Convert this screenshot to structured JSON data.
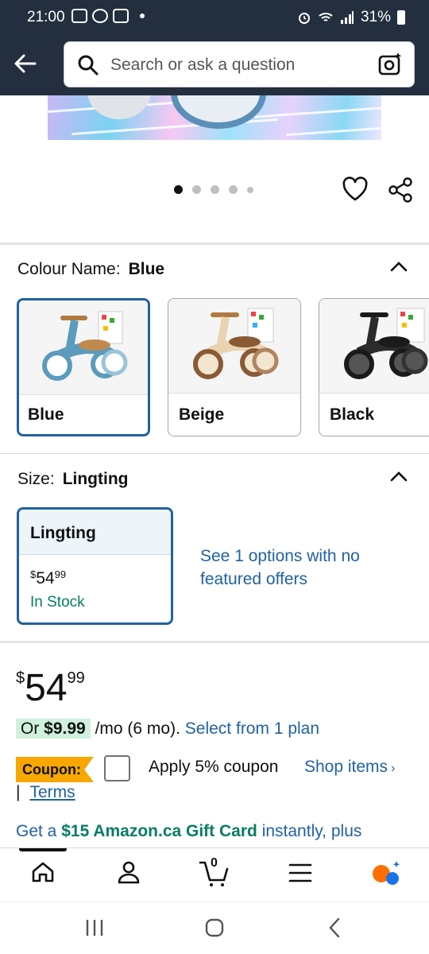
{
  "status_bar": {
    "time": "21:00",
    "battery": "31%"
  },
  "search": {
    "placeholder": "Search or ask a question"
  },
  "colour": {
    "label": "Colour Name:",
    "selected": "Blue",
    "options": [
      {
        "label": "Blue",
        "color": "#5b9bbd"
      },
      {
        "label": "Beige",
        "color": "#e9d3b0"
      },
      {
        "label": "Black",
        "color": "#2b2b2b"
      }
    ]
  },
  "size": {
    "label": "Size:",
    "selected": "Lingting",
    "option": {
      "name": "Lingting",
      "price_currency": "$",
      "price_whole": "54",
      "price_fraction": "99",
      "stock": "In Stock"
    },
    "see_options": "See 1 options with no featured offers"
  },
  "price": {
    "currency": "$",
    "whole": "54",
    "fraction": "99"
  },
  "monthly": {
    "prefix": "Or",
    "amount": "$9.99",
    "suffix": "/mo (6 mo).",
    "link": "Select from 1 plan"
  },
  "coupon": {
    "badge": "Coupon:",
    "text": "Apply 5% coupon",
    "shop_link": "Shop items",
    "terms_link": "Terms",
    "separator": "|"
  },
  "gift": {
    "prefix": "Get a",
    "highlight": "$15 Amazon.ca Gift Card",
    "suffix": "instantly, plus"
  },
  "cart": {
    "count": "0"
  },
  "carousel": {
    "total": 5,
    "active": 0
  },
  "colors": {
    "accent": "#2162a1",
    "header": "#232f3e",
    "coupon": "#f7a700",
    "deal": "#cff0dc",
    "stock": "#067d62"
  }
}
